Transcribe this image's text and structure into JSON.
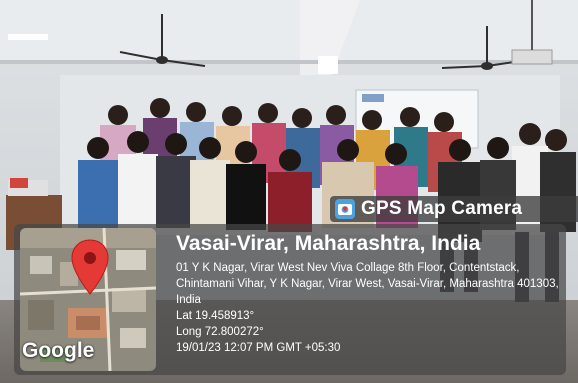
{
  "badge": {
    "label": "GPS Map Camera",
    "icon": "gps-camera-icon"
  },
  "location": {
    "place": "Vasai-Virar, Maharashtra, India",
    "address": "01 Y K Nagar, Virar West Nev Viva Collage 8th Floor, Contentstack, Chintamani Vihar, Y K Nagar, Virar West, Vasai-Virar, Maharashtra 401303, India",
    "lat": "Lat 19.458913°",
    "long": "Long 72.800272°",
    "datetime": "19/01/23 12:07 PM GMT +05:30"
  },
  "map": {
    "brand": "Google",
    "pin_icon": "map-pin-icon",
    "pin_color": "#e53935"
  },
  "colors": {
    "overlay": "#464646",
    "text": "#ffffff"
  }
}
